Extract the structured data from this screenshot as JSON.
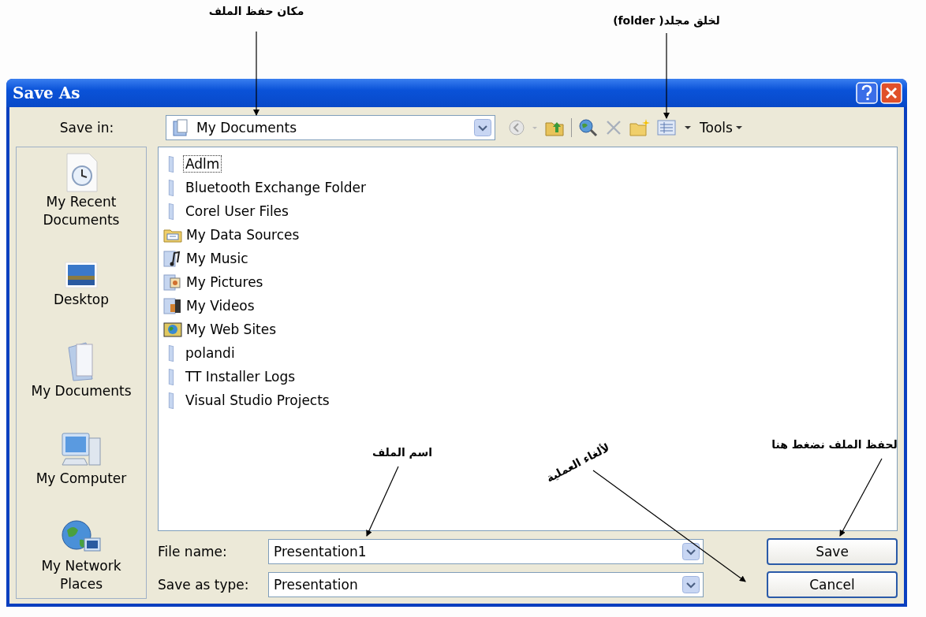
{
  "annotations": [
    {
      "text": "مكان حفظ الملف"
    },
    {
      "text": "لخلق مجلد( folder)"
    },
    {
      "text": "اسم الملف"
    },
    {
      "text": "لألغاء العملية"
    },
    {
      "text": "لحفظ الملف نضغط هنا"
    }
  ],
  "window": {
    "title": "Save As"
  },
  "save_in": {
    "label": "Save in:",
    "value": "My Documents"
  },
  "toolbar": {
    "tools": "Tools"
  },
  "places": [
    {
      "kind": "recent",
      "label": "My Recent Documents"
    },
    {
      "kind": "desktop",
      "label": "Desktop"
    },
    {
      "kind": "documents",
      "label": "My Documents"
    },
    {
      "kind": "computer",
      "label": "My Computer"
    },
    {
      "kind": "network",
      "label": "My Network Places"
    }
  ],
  "files": [
    {
      "kind": "folder",
      "name": "Adlm",
      "selected": true
    },
    {
      "kind": "folder",
      "name": "Bluetooth Exchange Folder",
      "selected": false
    },
    {
      "kind": "folder",
      "name": "Corel User Files",
      "selected": false
    },
    {
      "kind": "data",
      "name": "My Data Sources",
      "selected": false
    },
    {
      "kind": "music",
      "name": "My Music",
      "selected": false
    },
    {
      "kind": "pictures",
      "name": "My Pictures",
      "selected": false
    },
    {
      "kind": "videos",
      "name": "My Videos",
      "selected": false
    },
    {
      "kind": "web",
      "name": "My Web Sites",
      "selected": false
    },
    {
      "kind": "folder",
      "name": "polandi",
      "selected": false
    },
    {
      "kind": "folder",
      "name": "TT Installer Logs",
      "selected": false
    },
    {
      "kind": "folder",
      "name": "Visual Studio Projects",
      "selected": false
    }
  ],
  "file_name": {
    "label": "File name:",
    "value": "Presentation1"
  },
  "save_as_type": {
    "label": "Save as type:",
    "value": "Presentation"
  },
  "buttons": [
    {
      "label": "Save"
    },
    {
      "label": "Cancel"
    }
  ]
}
